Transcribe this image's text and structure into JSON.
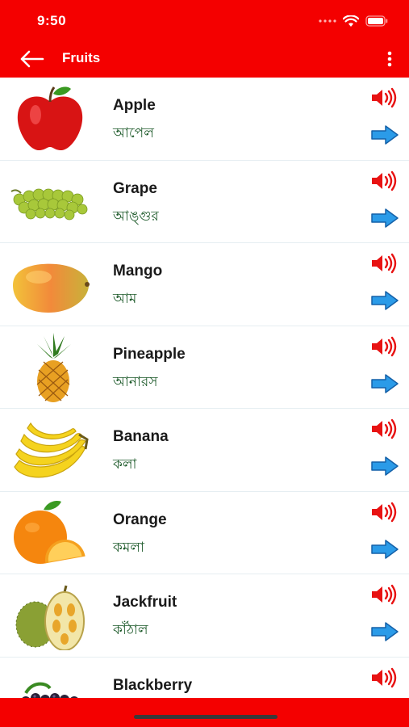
{
  "status": {
    "time": "9:50"
  },
  "header": {
    "title": "Fruits",
    "back_icon": "arrow-left-icon",
    "menu_icon": "more-vertical-icon"
  },
  "colors": {
    "brand": "#f40000",
    "speaker": "#e81313",
    "arrow": "#2b9be8",
    "native_text": "#1d5a2a"
  },
  "fruits": [
    {
      "name": "Apple",
      "native": "আপেল"
    },
    {
      "name": "Grape",
      "native": "আঙ্গুর"
    },
    {
      "name": "Mango",
      "native": "আম"
    },
    {
      "name": "Pineapple",
      "native": "আনারস"
    },
    {
      "name": "Banana",
      "native": "কলা"
    },
    {
      "name": "Orange",
      "native": "কমলা"
    },
    {
      "name": "Jackfruit",
      "native": "কাঁঠাল"
    },
    {
      "name": "Blackberry",
      "native": ""
    }
  ]
}
